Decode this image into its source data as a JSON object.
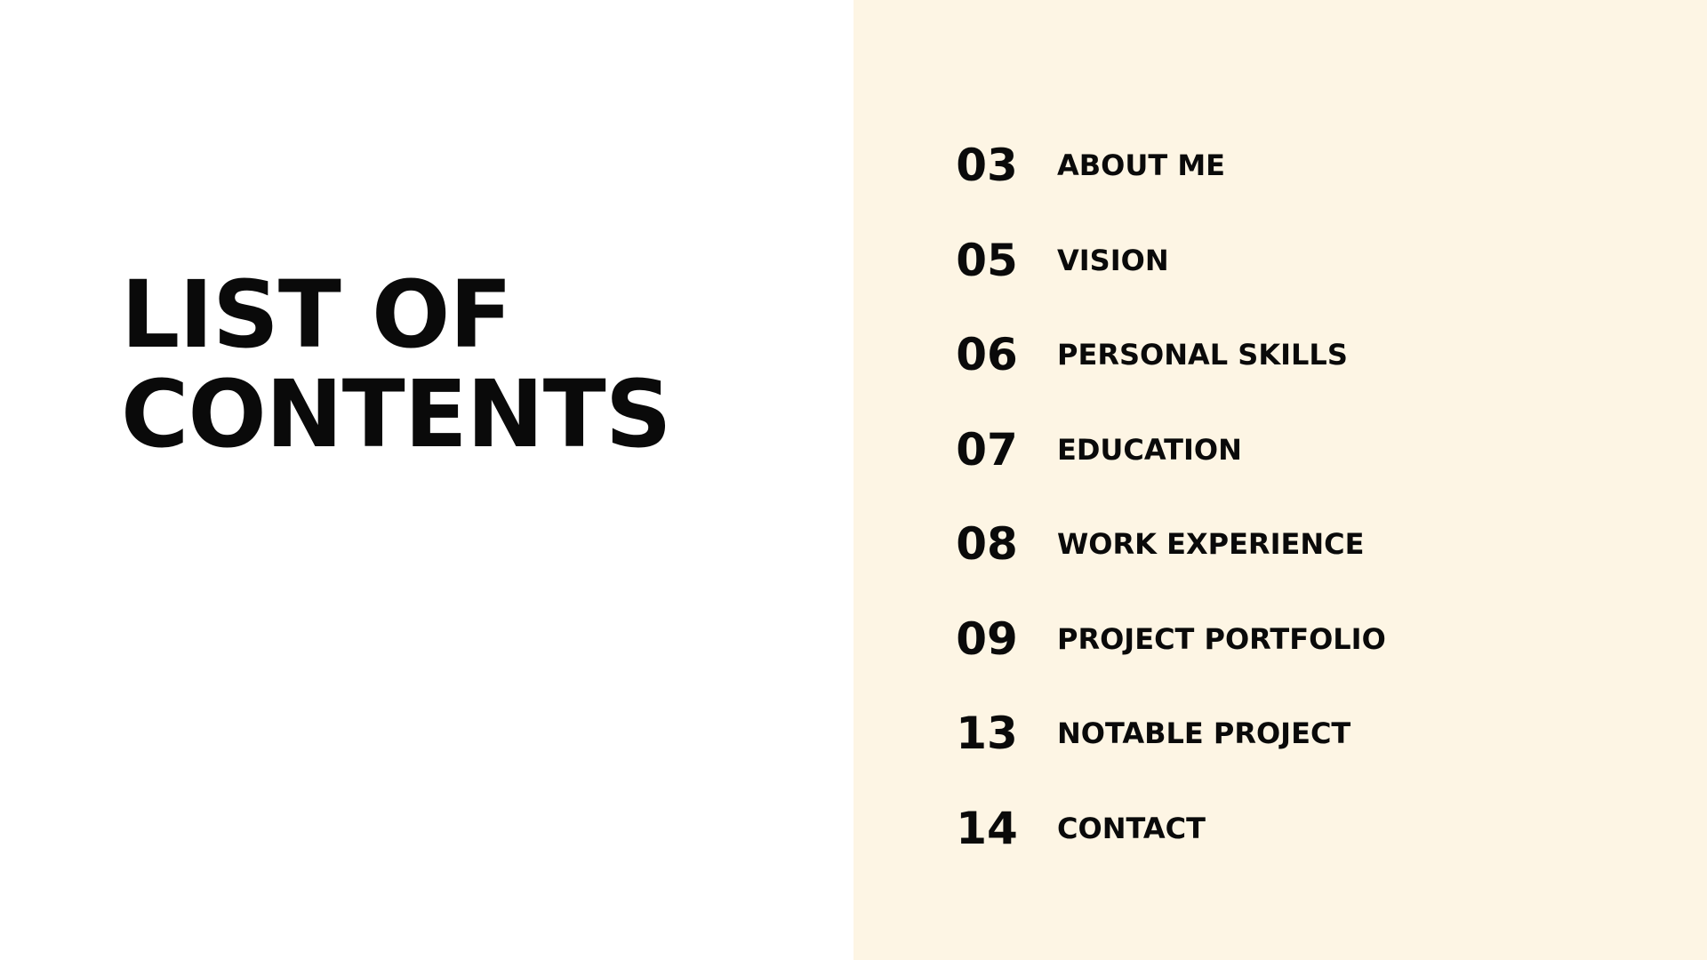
{
  "colors": {
    "left_background": "#ffffff",
    "right_background": "#fdf5e4",
    "text": "#0a0a0a"
  },
  "title": {
    "line1": "LIST OF",
    "line2": "CONTENTS"
  },
  "toc": [
    {
      "page": "03",
      "label": "ABOUT ME"
    },
    {
      "page": "05",
      "label": "VISION"
    },
    {
      "page": "06",
      "label": "PERSONAL SKILLS"
    },
    {
      "page": "07",
      "label": "EDUCATION"
    },
    {
      "page": "08",
      "label": "WORK EXPERIENCE"
    },
    {
      "page": "09",
      "label": "PROJECT PORTFOLIO"
    },
    {
      "page": "13",
      "label": "NOTABLE PROJECT"
    },
    {
      "page": "14",
      "label": "CONTACT"
    }
  ]
}
